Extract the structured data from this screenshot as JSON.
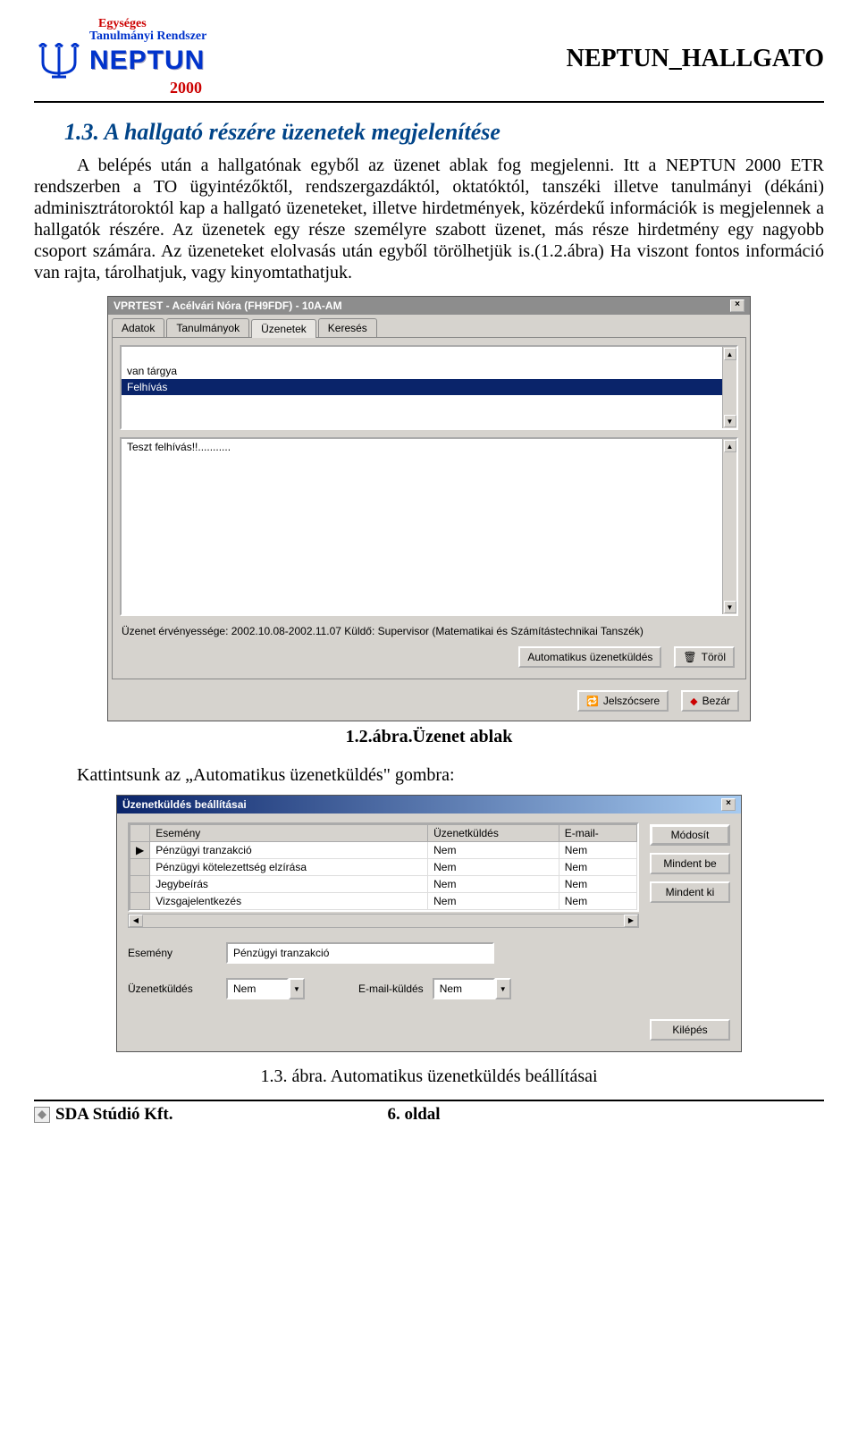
{
  "header": {
    "logo_line1": "Egységes",
    "logo_line2": "Tanulmányi  Rendszer",
    "logo_brand": "NEPTUN",
    "logo_year": "2000",
    "doc_title": "NEPTUN_HALLGATO"
  },
  "section": {
    "heading": "1.3. A hallgató részére üzenetek megjelenítése",
    "intro": "A belépés után a hallgatónak egyből az üzenet ablak fog megjelenni. Itt a NEPTUN 2000 ETR rendszerben a TO ügyintézőktől, rendszergazdáktól, oktatóktól, tanszéki illetve tanulmányi (dékáni) adminisztrátoroktól kap a hallgató üzeneteket, illetve hirdetmények, közérdekű információk is megjelennek a hallgatók részére. Az üzenetek egy része személyre szabott üzenet, más része hirdetmény egy nagyobb csoport számára. Az üzeneteket elolvasás után egyből törölhetjük is.(1.2.ábra) Ha viszont fontos információ van rajta, tárolhatjuk, vagy kinyomtathatjuk."
  },
  "fig1": {
    "window_title": "VPRTEST - Acélvári Nóra (FH9FDF) - 10A-AM",
    "tabs": [
      "Adatok",
      "Tanulmányok",
      "Üzenetek",
      "Keresés"
    ],
    "active_tab": 2,
    "list_items": [
      "van tárgya",
      "Felhívás"
    ],
    "selected_item": 1,
    "message_body": "Teszt felhívás!!...........",
    "status_line": "Üzenet érvényessége:  2002.10.08-2002.11.07  Küldő: Supervisor  (Matematikai és Számítástechnikai Tanszék)",
    "btn_autosend": "Automatikus üzenetküldés",
    "btn_delete": "Töröl",
    "btn_swap": "Jelszócsere",
    "btn_close": "Bezár",
    "caption": "1.2.ábra.Üzenet ablak"
  },
  "instr2": "Kattintsunk az „Automatikus üzenetküldés\" gombra:",
  "fig2": {
    "window_title": "Üzenetküldés beállításai",
    "columns": [
      "Esemény",
      "Üzenetküldés",
      "E-mail-"
    ],
    "rows": [
      {
        "marker": "▶",
        "event": "Pénzügyi tranzakció",
        "send": "Nem",
        "email": "Nem"
      },
      {
        "marker": "",
        "event": "Pénzügyi kötelezettség elzírása",
        "send": "Nem",
        "email": "Nem"
      },
      {
        "marker": "",
        "event": "Jegybeírás",
        "send": "Nem",
        "email": "Nem"
      },
      {
        "marker": "",
        "event": "Vizsgajelentkezés",
        "send": "Nem",
        "email": "Nem"
      }
    ],
    "btn_modify": "Módosít",
    "btn_all_on": "Mindent be",
    "btn_all_off": "Mindent ki",
    "label_event": "Esemény",
    "field_event_value": "Pénzügyi tranzakció",
    "label_send": "Üzenetküldés",
    "combo_send_value": "Nem",
    "label_email": "E-mail-küldés",
    "combo_email_value": "Nem",
    "btn_exit": "Kilépés",
    "caption": "1.3. ábra. Automatikus üzenetküldés beállításai"
  },
  "footer": {
    "company": "SDA Stúdió Kft.",
    "page": "6. oldal"
  }
}
